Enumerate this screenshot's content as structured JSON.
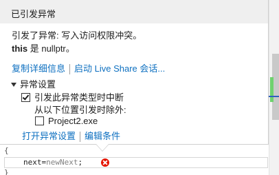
{
  "popup": {
    "title": "已引发异常",
    "message_line1": "引发了异常: 写入访问权限冲突。",
    "message_keyword": "this",
    "message_line2_rest": " 是 nullptr。",
    "links_top": {
      "copy_details": "复制详细信息",
      "live_share": "启动 Live Share 会话..."
    },
    "settings": {
      "section_label": "异常设置",
      "break_label": "引发此异常类型时中断",
      "break_checked": true,
      "except_label": "从以下位置引发时除外:",
      "module_label": "Project2.exe",
      "module_checked": false
    },
    "links_bottom": {
      "open_settings": "打开异常设置",
      "edit_conditions": "编辑条件"
    }
  },
  "code": {
    "brace_open": "{",
    "line_keyword": "next=",
    "line_ident": "newNext",
    "line_end": ";",
    "brace_close": "}"
  },
  "icons": {
    "collapse": "collapse-triangle-icon",
    "error": "error-circle-icon"
  },
  "colors": {
    "link": "#0e70c0",
    "header_bg": "#efefef",
    "error": "#e51400",
    "scroll_marker_green": "#6fd26f",
    "scroll_marker_blue": "#2e5fbf"
  }
}
